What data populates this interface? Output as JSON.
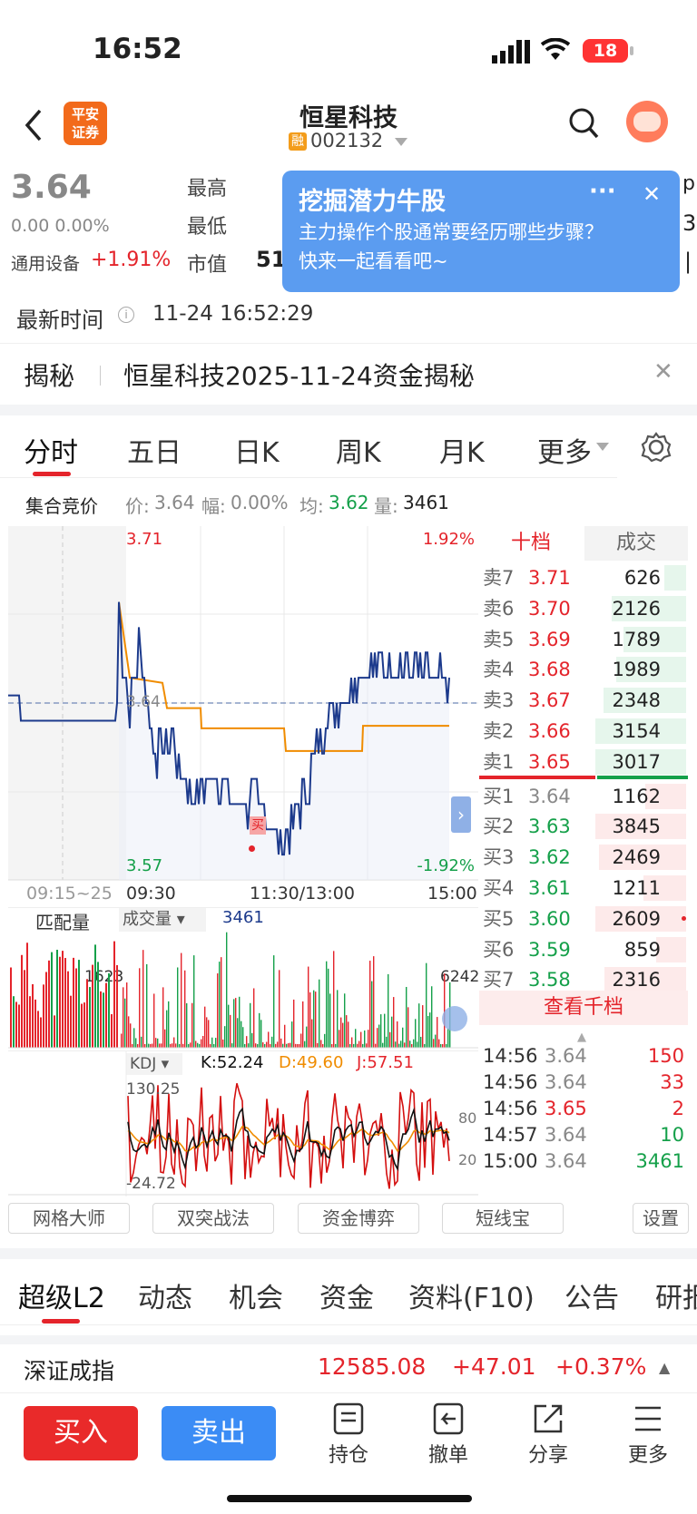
{
  "status": {
    "time": "16:52",
    "battery": "18"
  },
  "nav": {
    "broker_logo": "平安\n证券",
    "title": "恒星科技",
    "tag": "融",
    "code": "002132"
  },
  "quote": {
    "price": "3.64",
    "change": "0.00 0.00%",
    "sector": "通用设备",
    "sector_change": "+1.91%",
    "high_label": "最高",
    "low_label": "最低",
    "mcap_label": "市值",
    "mcap_value": "51",
    "latest_label": "最新时间",
    "latest_time": "11-24 16:52:29"
  },
  "popup": {
    "title": "挖掘潜力牛股",
    "body": "主力操作个股通常要经历哪些步骤？快来一起看看吧~",
    "more": "···",
    "close": "✕",
    "right_edge": [
      "p",
      "3",
      "|"
    ]
  },
  "reveal": {
    "label": "揭秘",
    "text": "恒星科技2025-11-24资金揭秘"
  },
  "chart_tabs": [
    "分时",
    "五日",
    "日K",
    "周K",
    "月K",
    "更多"
  ],
  "auction": {
    "label": "集合竞价",
    "price_label": "价:",
    "price": "3.64",
    "amp_label": "幅:",
    "amp": "0.00%",
    "avg_label": "均:",
    "avg": "3.62",
    "vol_label": "量:",
    "vol": "3461"
  },
  "chart_data": {
    "type": "line",
    "ylim": [
      3.57,
      3.71
    ],
    "ylim_pct": [
      "1.92%",
      "-1.92%"
    ],
    "y_top": "3.71",
    "y_bottom": "3.57",
    "y_mid": "3.64",
    "x_labels": [
      "09:15~25",
      "09:30",
      "11:30/13:00",
      "15:00"
    ],
    "volume": {
      "label_left": "匹配量",
      "label_mid": "成交量",
      "value": "3461",
      "left_max": "1623",
      "right_max": "6242"
    },
    "kdj": {
      "label": "KDJ",
      "K": "K:52.24",
      "D": "D:49.60",
      "J": "J:57.51",
      "top": "130.25",
      "bottom": "-24.72",
      "r1": "80",
      "r2": "20"
    },
    "buy_marker": "买"
  },
  "orderbook": {
    "tab1": "十档",
    "tab2": "成交",
    "sells": [
      {
        "l": "卖7",
        "p": "3.71",
        "v": "626",
        "w": 0.24
      },
      {
        "l": "卖6",
        "p": "3.70",
        "v": "2126",
        "w": 0.82
      },
      {
        "l": "卖5",
        "p": "3.69",
        "v": "1789",
        "w": 0.69
      },
      {
        "l": "卖4",
        "p": "3.68",
        "v": "1989",
        "w": 0.77
      },
      {
        "l": "卖3",
        "p": "3.67",
        "v": "2348",
        "w": 0.91
      },
      {
        "l": "卖2",
        "p": "3.66",
        "v": "3154",
        "w": 1.0
      },
      {
        "l": "卖1",
        "p": "3.65",
        "v": "3017",
        "w": 1.0
      }
    ],
    "buys": [
      {
        "l": "买1",
        "p": "3.64",
        "v": "1162",
        "w": 0.45
      },
      {
        "l": "买2",
        "p": "3.63",
        "v": "3845",
        "w": 1.0
      },
      {
        "l": "买3",
        "p": "3.62",
        "v": "2469",
        "w": 0.96
      },
      {
        "l": "买4",
        "p": "3.61",
        "v": "1211",
        "w": 0.47
      },
      {
        "l": "买5",
        "p": "3.60",
        "v": "2609",
        "w": 1.0
      },
      {
        "l": "买6",
        "p": "3.59",
        "v": "859",
        "w": 0.33
      },
      {
        "l": "买7",
        "p": "3.58",
        "v": "2316",
        "w": 0.9
      }
    ],
    "view_more": "查看千档"
  },
  "trades": [
    {
      "t": "14:56",
      "p": "3.64",
      "v": "150"
    },
    {
      "t": "14:56",
      "p": "3.64",
      "v": "33"
    },
    {
      "t": "14:56",
      "p": "3.65",
      "v": "2"
    },
    {
      "t": "14:57",
      "p": "3.64",
      "v": "10"
    },
    {
      "t": "15:00",
      "p": "3.64",
      "v": "3461"
    }
  ],
  "tools": [
    "网格大师",
    "双突战法",
    "资金博弈",
    "短线宝",
    "设置"
  ],
  "sub_tabs": [
    "超级L2",
    "动态",
    "机会",
    "资金",
    "资料(F10)",
    "公告",
    "研报"
  ],
  "index": {
    "name": "深证成指",
    "value": "12585.08",
    "change": "+47.01",
    "pct": "+0.37%"
  },
  "bottom": {
    "buy": "买入",
    "sell": "卖出",
    "hold": "持仓",
    "cancel": "撤单",
    "share": "分享",
    "more": "更多"
  },
  "colors": {
    "red": "#e4242b",
    "green": "#15a04a",
    "blue": "#1c3a8c",
    "orange": "#f08c00",
    "popup": "#5b9cf0"
  }
}
